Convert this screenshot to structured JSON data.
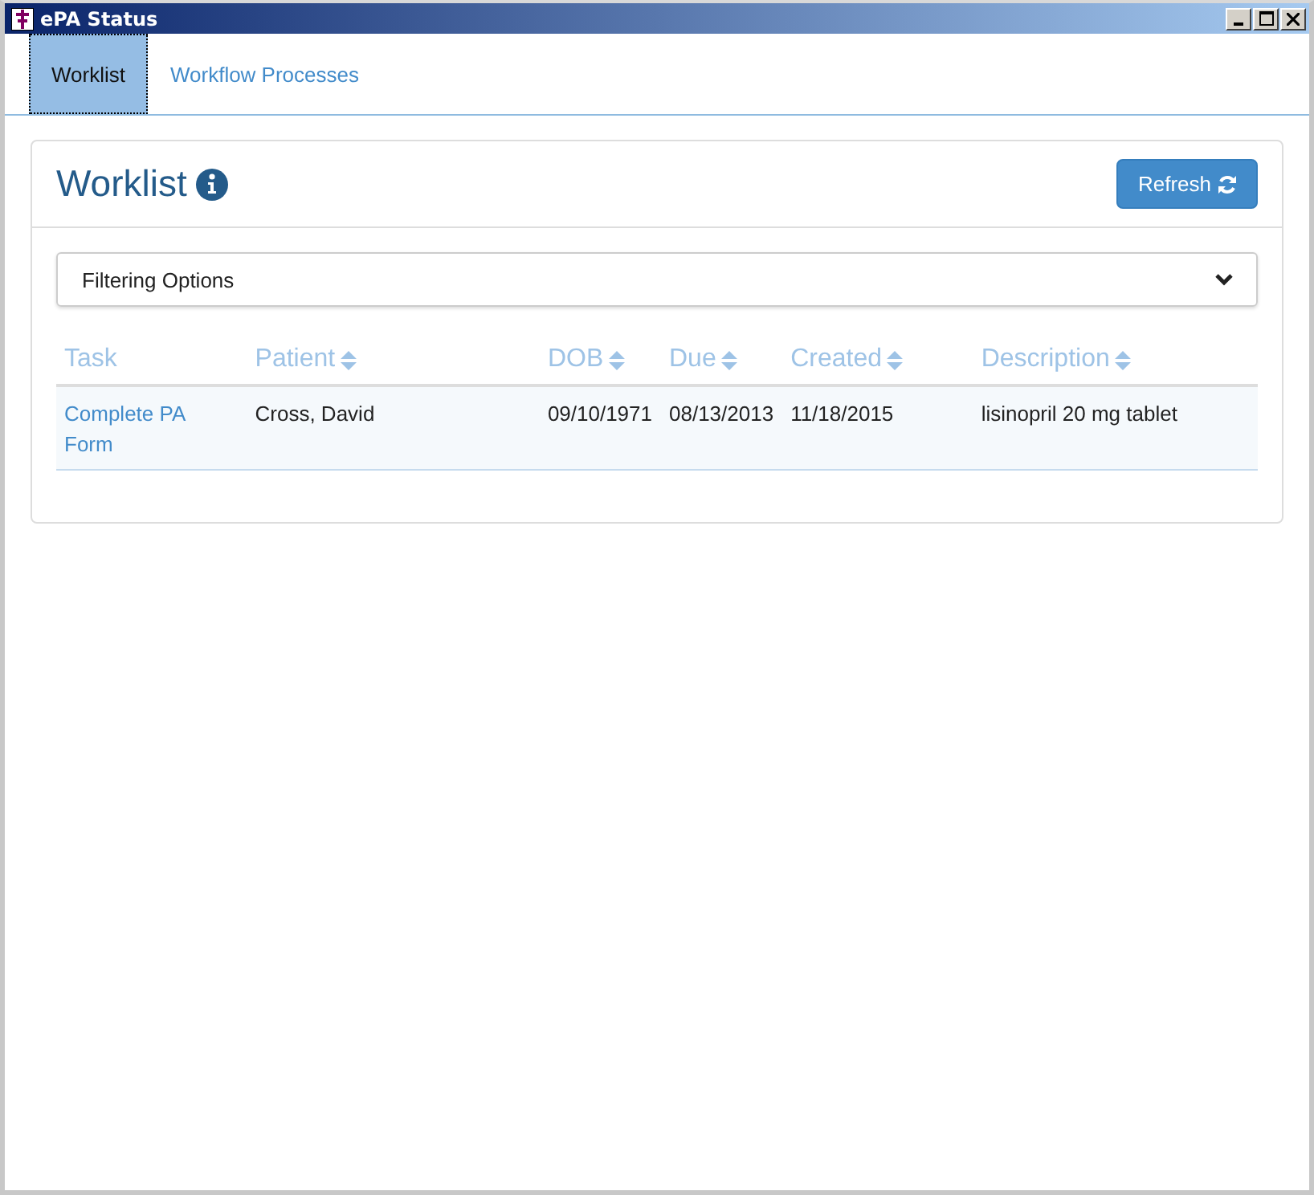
{
  "window": {
    "title": "ePA Status"
  },
  "tabs": [
    {
      "label": "Worklist",
      "selected": true
    },
    {
      "label": "Workflow Processes",
      "selected": false
    }
  ],
  "panel": {
    "title": "Worklist",
    "refresh_button": "Refresh"
  },
  "filter": {
    "label": "Filtering Options",
    "expanded": false
  },
  "table": {
    "columns": [
      {
        "label": "Task",
        "sortable": false
      },
      {
        "label": "Patient",
        "sortable": true
      },
      {
        "label": "DOB",
        "sortable": true
      },
      {
        "label": "Due",
        "sortable": true
      },
      {
        "label": "Created",
        "sortable": true
      },
      {
        "label": "Description",
        "sortable": true
      }
    ],
    "rows": [
      {
        "cells": [
          "Complete PA Form",
          "Cross, David",
          "09/10/1971",
          "08/13/2013",
          "11/18/2015",
          "lisinopril 20 mg tablet"
        ]
      }
    ]
  }
}
